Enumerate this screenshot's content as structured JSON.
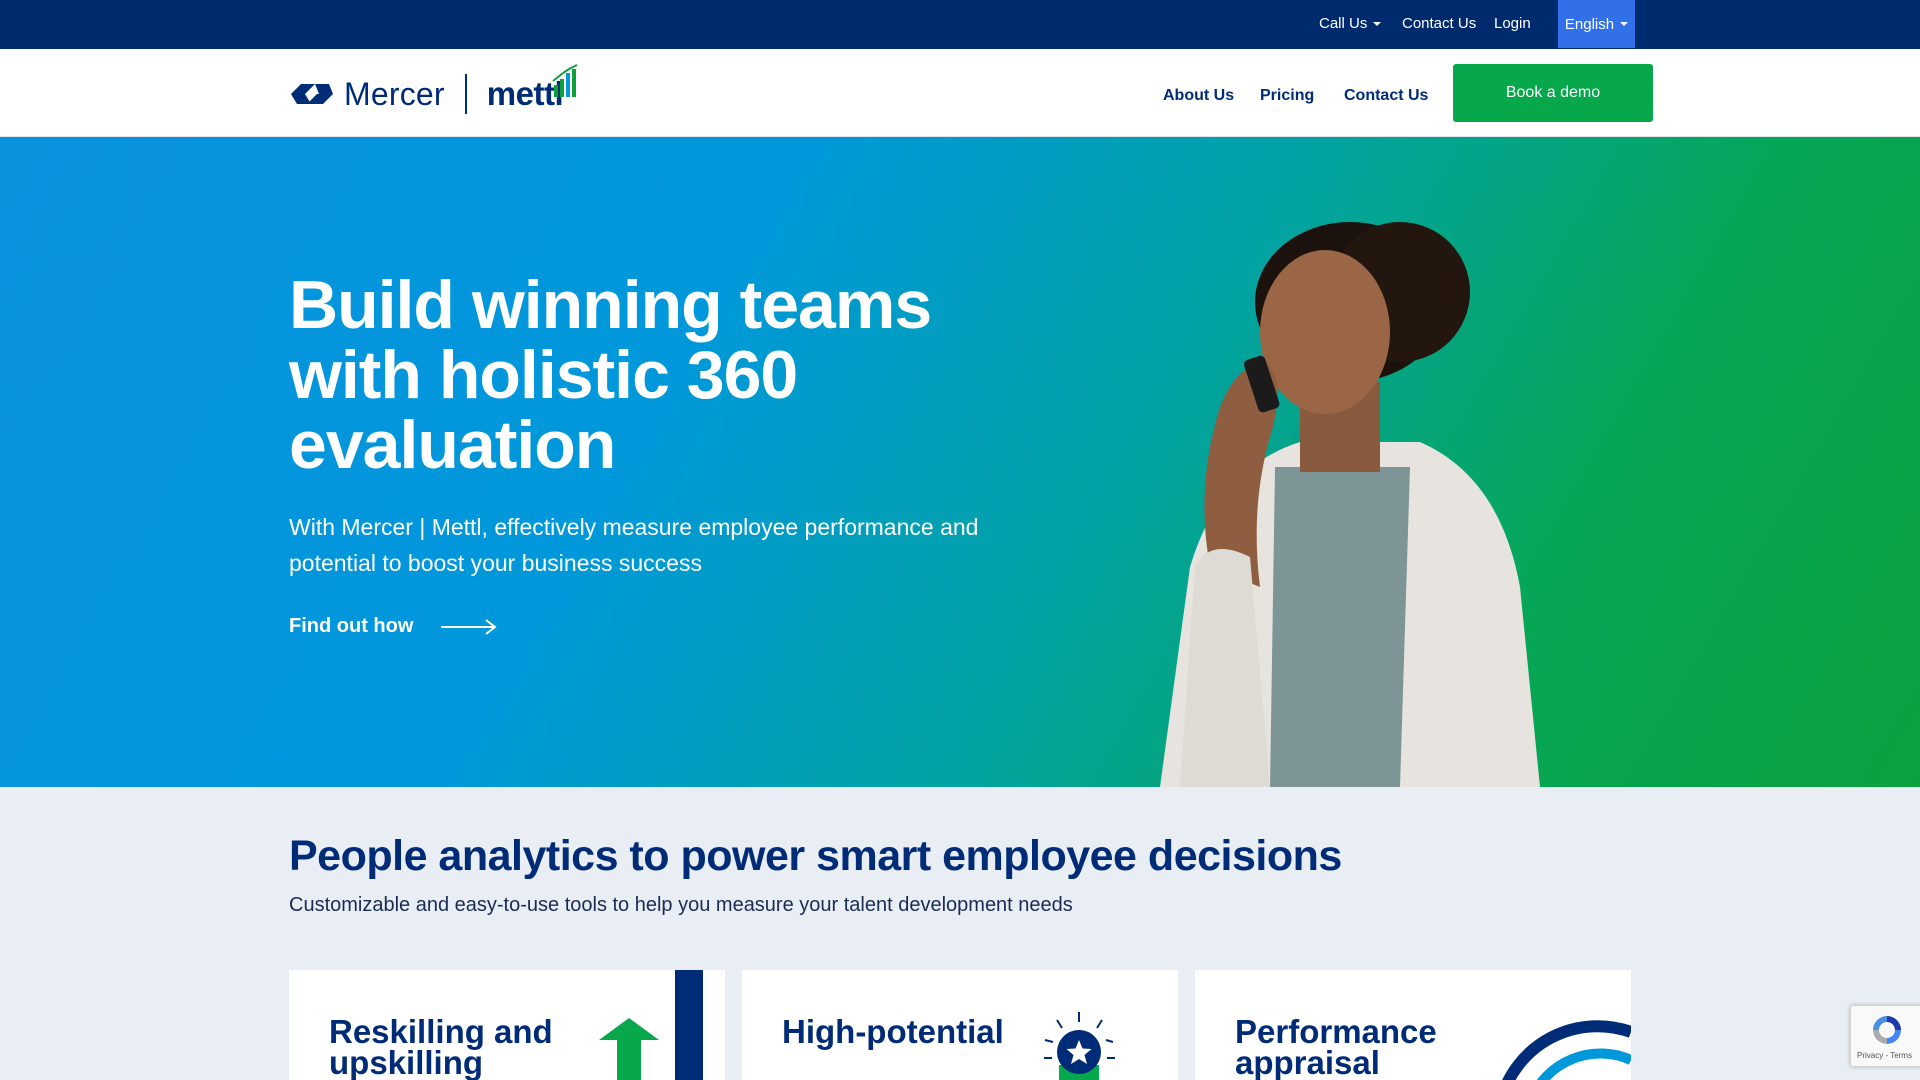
{
  "utility_bar": {
    "call_us": "Call Us",
    "contact_us": "Contact Us",
    "login": "Login",
    "language": "English"
  },
  "nav": {
    "brand_mercer": "Mercer",
    "brand_mettl": "mettl",
    "about": "About Us",
    "pricing": "Pricing",
    "contact": "Contact Us",
    "demo": "Book a demo"
  },
  "hero": {
    "title": "Build winning teams with holistic 360 evaluation",
    "subtitle": "With Mercer | Mettl, effectively measure employee performance and potential to boost your business success",
    "cta": "Find out how"
  },
  "analytics": {
    "title": "People analytics to power smart employee decisions",
    "subtitle": "Customizable and easy-to-use tools to help you measure your talent development needs",
    "cards": [
      {
        "title": "Reskilling and upskilling"
      },
      {
        "title": "High-potential"
      },
      {
        "title": "Performance appraisal"
      }
    ]
  },
  "recaptcha": {
    "links": "Privacy - Terms"
  },
  "colors": {
    "navy": "#002c77",
    "utility_bar": "#002a6e",
    "language_button": "#3170e8",
    "demo_button": "#07a84c",
    "hero_gradient_start": "#0098db",
    "hero_gradient_end": "#0ba23e"
  }
}
